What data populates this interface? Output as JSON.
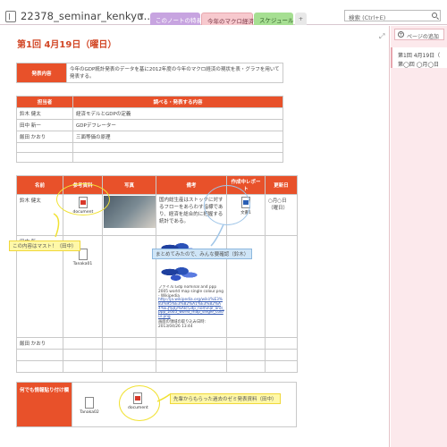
{
  "app": {
    "notebook_title": "22378_seminar_kenkyu...",
    "tabs": [
      "このノートの特長",
      "今年のマクロ経済",
      "スケジュール",
      "+"
    ],
    "search_placeholder": "検索 (Ctrl+E)"
  },
  "page": {
    "title": "第1回 4月19日（曜日）"
  },
  "side": {
    "add_page": "ページの追加",
    "items": [
      "第1回 4月19日（",
      "第◯回 ◯月◯日"
    ]
  },
  "intro_table": {
    "header": "発表内容",
    "text": "今年のGDP統計発表のデータを基に2012年度の今年のマクロ経済の現状を表・グラフを用いて発表する。"
  },
  "assign_table": {
    "headers": [
      "担当者",
      "調べる・発表する内容"
    ],
    "rows": [
      [
        "鈴木 健太",
        "経済モデルとGDPの定義"
      ],
      [
        "田中 新一",
        "GDPデフレーター"
      ],
      [
        "飯田 かおり",
        "三面等価の原理"
      ],
      [
        "",
        ""
      ]
    ]
  },
  "materials_table": {
    "headers": [
      "名前",
      "参考資料",
      "写真",
      "備考",
      "作成中レポート",
      "更新日"
    ],
    "rows": [
      {
        "name": "鈴木 健太",
        "file": "document",
        "note": "国内総生産はストックに対するフローをあらわす指標であり、経済を総合的に把握する統計である。",
        "report": "文書1",
        "date": "○月○日（曜日）"
      },
      {
        "name": "田中 新一",
        "file": "Tanaka01",
        "note_caption": "ファイル:Gdp nominal and ppp 2005 world map single colour.png - Wikipedia",
        "note_link": "http://ja.wikipedia.org/wiki/%E3%83%95%E3%82%A1%E3%82%A4%E3%83%AB:Gdp_nominal_and_ppp_2005_world_map_single_colour.png",
        "note_clip": "画面の領域の取り込み日時: 2013/04/26 13:44"
      },
      {
        "name": "飯田 かおり"
      },
      {
        "name": ""
      },
      {
        "name": ""
      }
    ]
  },
  "free_table": {
    "header": "何でも情報貼り付け欄",
    "files": [
      "Tanaka02",
      "document"
    ]
  },
  "annotations": {
    "must": "この内容はマスト！（田中）",
    "summary": "まとめてみたので、みんな要確認（鈴木）",
    "prev": "先輩からもらった過去のゼミ発表資料（田中）"
  },
  "colors": {
    "accent": "#e8512a",
    "title": "#d24726",
    "tab_active": "#f7c9ce",
    "section_bg": "#fce9ec"
  }
}
